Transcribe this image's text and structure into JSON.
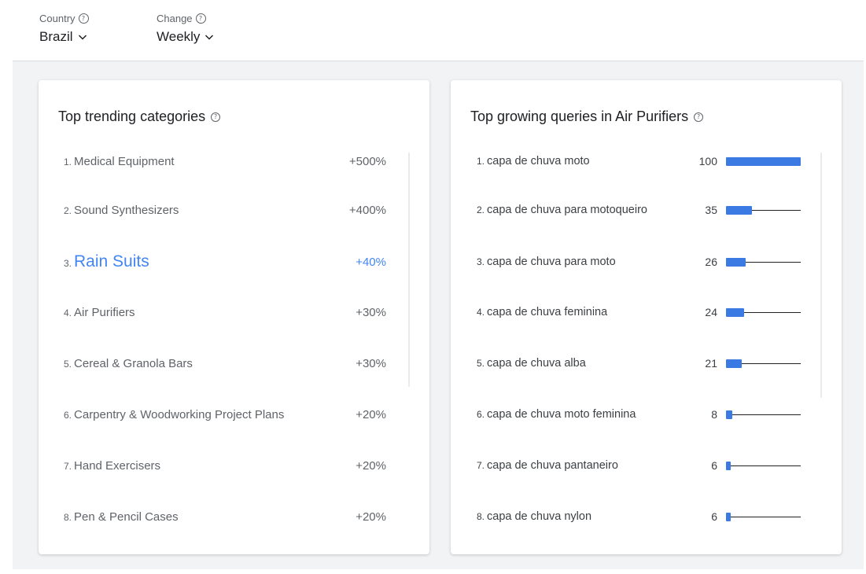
{
  "filters": {
    "country": {
      "label": "Country",
      "value": "Brazil"
    },
    "change": {
      "label": "Change",
      "value": "Weekly"
    }
  },
  "colors": {
    "accent": "#4285f4",
    "bar": "#3b7ae3"
  },
  "categories_card": {
    "title": "Top trending categories",
    "items": [
      {
        "num": "1.",
        "name": "Medical Equipment",
        "pct": "+500%"
      },
      {
        "num": "2.",
        "name": "Sound Synthesizers",
        "pct": "+400%"
      },
      {
        "num": "3.",
        "name": "Rain Suits",
        "pct": "+40%",
        "selected": true
      },
      {
        "num": "4.",
        "name": "Air Purifiers",
        "pct": "+30%"
      },
      {
        "num": "5.",
        "name": "Cereal & Granola Bars",
        "pct": "+30%"
      },
      {
        "num": "6.",
        "name": "Carpentry & Woodworking Project Plans",
        "pct": "+20%"
      },
      {
        "num": "7.",
        "name": "Hand Exercisers",
        "pct": "+20%"
      },
      {
        "num": "8.",
        "name": "Pen & Pencil Cases",
        "pct": "+20%"
      }
    ]
  },
  "queries_card": {
    "title": "Top growing queries in Air Purifiers",
    "items": [
      {
        "num": "1.",
        "name": "capa de chuva moto",
        "value": "100",
        "level": 100
      },
      {
        "num": "2.",
        "name": "capa de chuva para motoqueiro",
        "value": "35",
        "level": 35
      },
      {
        "num": "3.",
        "name": "capa de chuva para moto",
        "value": "26",
        "level": 26
      },
      {
        "num": "4.",
        "name": "capa de chuva feminina",
        "value": "24",
        "level": 24
      },
      {
        "num": "5.",
        "name": "capa de chuva alba",
        "value": "21",
        "level": 21
      },
      {
        "num": "6.",
        "name": "capa de chuva moto feminina",
        "value": "8",
        "level": 8
      },
      {
        "num": "7.",
        "name": "capa de chuva pantaneiro",
        "value": "6",
        "level": 6
      },
      {
        "num": "8.",
        "name": "capa de chuva nylon",
        "value": "6",
        "level": 6
      }
    ]
  }
}
